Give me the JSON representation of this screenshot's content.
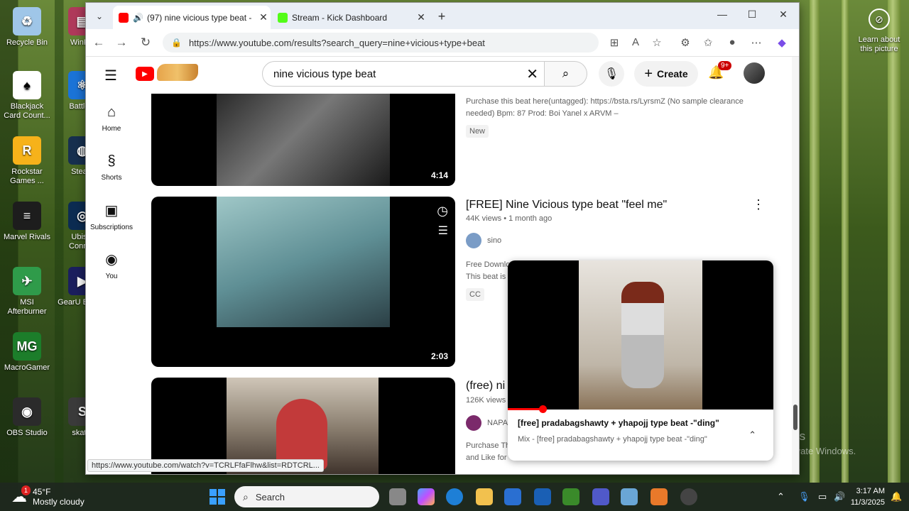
{
  "desktop": {
    "icons": [
      {
        "label": "Recycle Bin",
        "color": "#9fc6e8",
        "glyph": "♻"
      },
      {
        "label": "WinRA",
        "color": "#b03a5b",
        "glyph": "▤"
      },
      {
        "label": "Blackjack Card Count...",
        "color": "#ffffff",
        "glyph": "♠"
      },
      {
        "label": "Battle.n",
        "color": "#1b74d8",
        "glyph": "⚛"
      },
      {
        "label": "Rockstar Games ...",
        "color": "#f6b21a",
        "glyph": "R"
      },
      {
        "label": "Steam",
        "color": "#17304f",
        "glyph": "◍"
      },
      {
        "label": "Marvel Rivals",
        "color": "#1d1d1d",
        "glyph": "≡"
      },
      {
        "label": "Ubisof Connec",
        "color": "#0c2c52",
        "glyph": "◎"
      },
      {
        "label": "MSI Afterburner",
        "color": "#2f9b4a",
        "glyph": "✈"
      },
      {
        "label": "GearU Booste",
        "color": "#1b1f5e",
        "glyph": "▶"
      },
      {
        "label": "MacroGamer",
        "color": "#1c7d2a",
        "glyph": "MG"
      },
      {
        "label": "OBS Studio",
        "color": "#2b2b2b",
        "glyph": "◉"
      },
      {
        "label": "skate.",
        "color": "#3b3b3b",
        "glyph": "S"
      }
    ],
    "learn_label": "Learn about this picture",
    "watermark_line1": "Activate Windows",
    "watermark_line2": "Go to Settings to activate Windows."
  },
  "browser": {
    "tabs": [
      {
        "title": "(97) nine vicious type beat -",
        "favicon_color": "#ff0000"
      },
      {
        "title": "Stream - Kick Dashboard",
        "favicon_color": "#53fc18"
      }
    ],
    "url": "https://www.youtube.com/results?search_query=nine+vicious+type+beat",
    "status_url": "https://www.youtube.com/watch?v=TCRLFfaFlhw&list=RDTCRL..."
  },
  "youtube": {
    "search_value": "nine vicious type beat",
    "create_label": "Create",
    "notif_badge": "9+",
    "sidebar": [
      {
        "label": "Home",
        "icon": "⌂"
      },
      {
        "label": "Shorts",
        "icon": "§"
      },
      {
        "label": "Subscriptions",
        "icon": "▣"
      },
      {
        "label": "You",
        "icon": "◉"
      }
    ],
    "results": [
      {
        "duration": "4:14",
        "desc": "Purchase this beat here(untagged): https://bsta.rs/LyrsmZ (No sample clearance needed) Bpm: 87 Prod: Boi Yanel x ARVM –",
        "chip": "New"
      },
      {
        "title": "[FREE] Nine Vicious type beat \"feel me\"",
        "views": "44K views",
        "age": "1 month ago",
        "channel": "sino",
        "desc_line1": "Free Downlo",
        "desc_line2": "This beat is",
        "chip": "CC",
        "duration": "2:03"
      },
      {
        "title": "(free) ni",
        "views": "126K views",
        "channel": "NAPA",
        "desc_line1": "Purchase Th",
        "desc_line2": "and Like for"
      }
    ],
    "miniplayer": {
      "title": "[free] pradabagshawty + yhapojj type beat -\"ding\"",
      "subtitle": "Mix - [free] pradabagshawty + yhapojj type beat -\"ding\"",
      "progress": 0.13
    }
  },
  "taskbar": {
    "temp": "45°F",
    "condition": "Mostly cloudy",
    "weather_badge": "1",
    "search_placeholder": "Search",
    "time": "3:17 AM",
    "date": "11/3/2025"
  }
}
